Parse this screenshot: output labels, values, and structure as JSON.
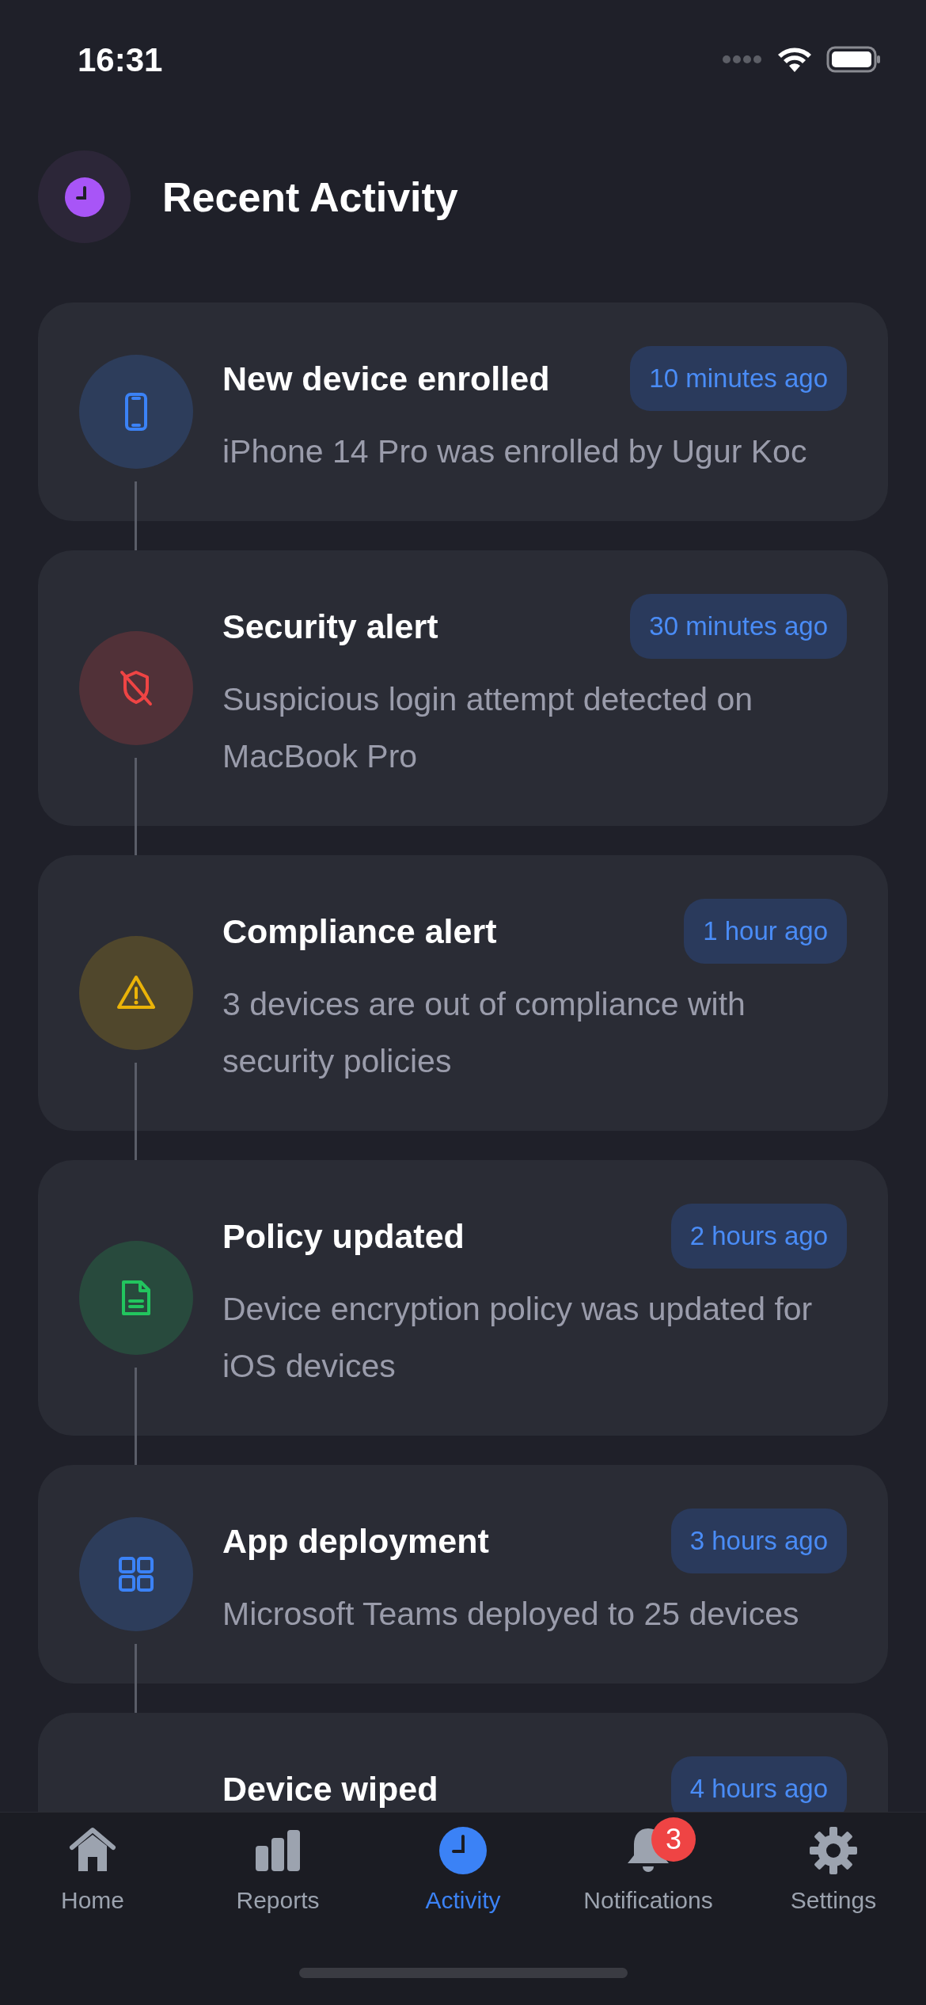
{
  "status_bar": {
    "time": "16:31"
  },
  "header": {
    "title": "Recent Activity"
  },
  "activities": [
    {
      "kind": "device",
      "color": "#3b82f6",
      "title": "New device enrolled",
      "time": "10 minutes ago",
      "description": "iPhone 14 Pro was enrolled by Ugur Koc"
    },
    {
      "kind": "security",
      "color": "#ef4444",
      "title": "Security alert",
      "time": "30 minutes ago",
      "description": "Suspicious login attempt detected on MacBook Pro"
    },
    {
      "kind": "compliance",
      "color": "#eab308",
      "title": "Compliance alert",
      "time": "1 hour ago",
      "description": "3 devices are out of compliance with security policies"
    },
    {
      "kind": "policy",
      "color": "#22c55e",
      "title": "Policy updated",
      "time": "2 hours ago",
      "description": "Device encryption policy was updated for iOS devices"
    },
    {
      "kind": "app",
      "color": "#3b82f6",
      "title": "App deployment",
      "time": "3 hours ago",
      "description": "Microsoft Teams deployed to 25 devices"
    },
    {
      "title": "Device wiped",
      "time": "4 hours ago"
    }
  ],
  "tab_bar": [
    {
      "kind": "home",
      "label": "Home",
      "selected": false
    },
    {
      "kind": "reports",
      "label": "Reports",
      "selected": false
    },
    {
      "kind": "activity",
      "label": "Activity",
      "selected": true
    },
    {
      "kind": "notifications",
      "label": "Notifications",
      "selected": false,
      "badge": "3"
    },
    {
      "kind": "settings",
      "label": "Settings",
      "selected": false
    }
  ]
}
